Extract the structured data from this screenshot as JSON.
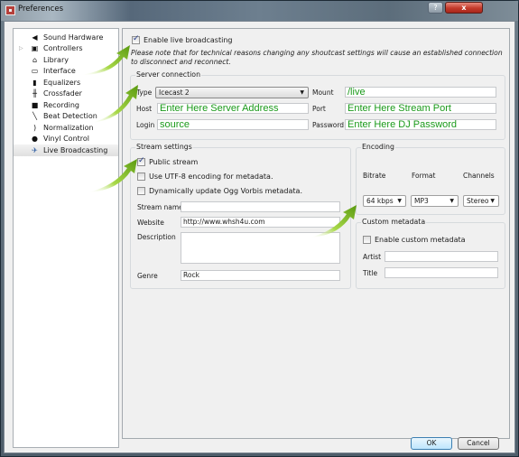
{
  "window": {
    "title": "Preferences",
    "help_label": "?",
    "close_label": "x"
  },
  "sidebar": {
    "items": [
      {
        "label": "Sound Hardware",
        "icon": "speaker-icon",
        "glyph": "◀"
      },
      {
        "label": "Controllers",
        "icon": "controller-icon",
        "glyph": "▣",
        "expandable": true
      },
      {
        "label": "Library",
        "icon": "library-icon",
        "glyph": "⌂"
      },
      {
        "label": "Interface",
        "icon": "monitor-icon",
        "glyph": "▭"
      },
      {
        "label": "Equalizers",
        "icon": "equalizer-icon",
        "glyph": "▮"
      },
      {
        "label": "Crossfader",
        "icon": "crossfader-icon",
        "glyph": "╫"
      },
      {
        "label": "Recording",
        "icon": "recording-icon",
        "glyph": "■"
      },
      {
        "label": "Beat Detection",
        "icon": "beat-detection-icon",
        "glyph": "╲"
      },
      {
        "label": "Normalization",
        "icon": "normalization-icon",
        "glyph": ")"
      },
      {
        "label": "Vinyl Control",
        "icon": "vinyl-icon",
        "glyph": "●"
      },
      {
        "label": "Live Broadcasting",
        "icon": "satellite-dish-icon",
        "glyph": "✈",
        "selected": true
      }
    ]
  },
  "broadcast": {
    "enable_label": "Enable live broadcasting",
    "enable_checked": true,
    "note": "Please note that for technical reasons changing any shoutcast settings will cause an established connection to disconnect and reconnect."
  },
  "server_connection": {
    "title": "Server connection",
    "type_label": "Type",
    "type_value": "Icecast 2",
    "host_label": "Host",
    "host_value": "Enter Here Server Address",
    "login_label": "Login",
    "login_value": "source",
    "mount_label": "Mount",
    "mount_value": "/live",
    "port_label": "Port",
    "port_value": "Enter Here Stream Port",
    "password_label": "Password",
    "password_value": "Enter Here DJ Password"
  },
  "stream_settings": {
    "title": "Stream settings",
    "public_label": "Public stream",
    "public_checked": true,
    "utf8_label": "Use UTF-8 encoding for metadata.",
    "utf8_checked": false,
    "ogg_label": "Dynamically update Ogg Vorbis metadata.",
    "ogg_checked": false,
    "name_label": "Stream name",
    "name_value": "",
    "website_label": "Website",
    "website_value": "http://www.whsh4u.com",
    "description_label": "Description",
    "description_value": "",
    "genre_label": "Genre",
    "genre_value": "Rock"
  },
  "encoding": {
    "title": "Encoding",
    "bitrate_label": "Bitrate",
    "format_label": "Format",
    "channels_label": "Channels",
    "bitrate_value": "64 kbps",
    "format_value": "MP3",
    "channels_value": "Stereo"
  },
  "custom_metadata": {
    "title": "Custom metadata",
    "enable_label": "Enable custom metadata",
    "enable_checked": false,
    "artist_label": "Artist",
    "artist_value": "",
    "title_label": "Title",
    "title_value": ""
  },
  "footer": {
    "ok_label": "OK",
    "cancel_label": "Cancel"
  },
  "colors": {
    "annotation_green": "#1a9a1a",
    "arrow_green": "#7cc21e"
  }
}
